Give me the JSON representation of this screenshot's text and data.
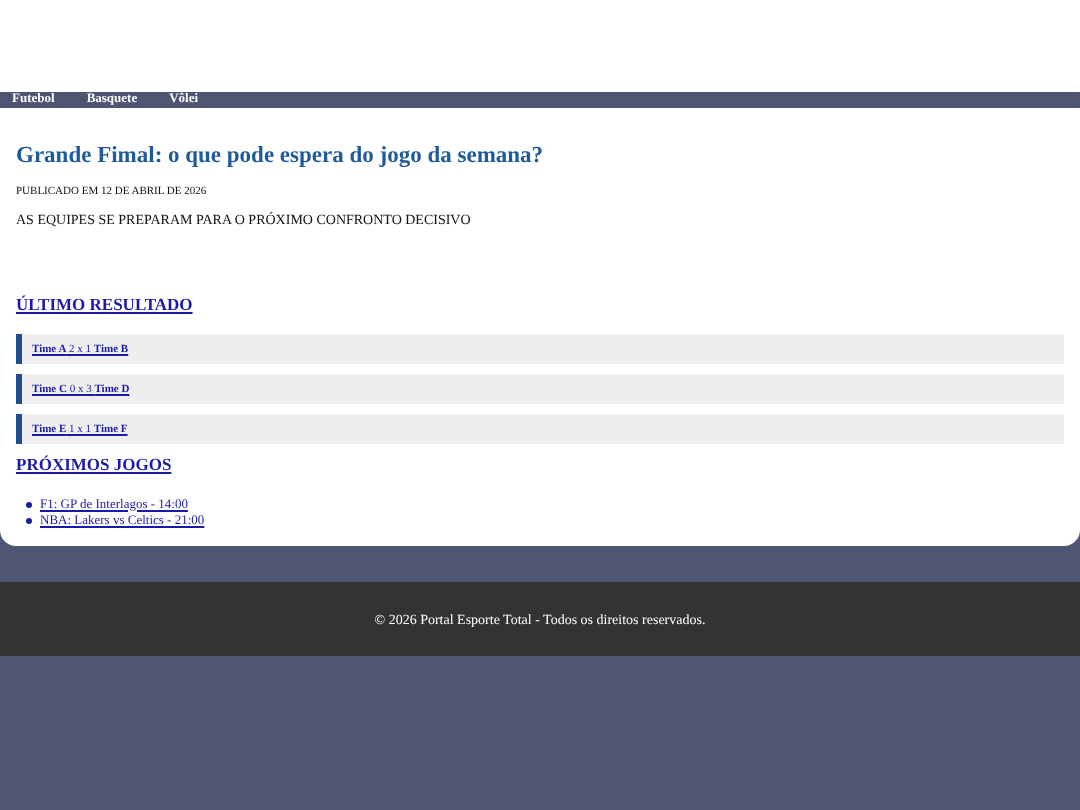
{
  "nav": {
    "items": [
      "Futebol",
      "Basquete",
      "Vôlei"
    ]
  },
  "article": {
    "title": "Grande Fimal: o que pode espera do jogo da semana?",
    "date": "PUBLICADO EM 12 DE ABRIL DE 2026",
    "subtitle": "AS EQUIPES SE PREPARAM PARA O PRÓXIMO CONFRONTO DECISIVO"
  },
  "results": {
    "heading": "ÚLTIMO RESULTADO",
    "items": [
      "**Time A** 2 x 1 **Time B**",
      "**Time C** 0 x 3 **Time D**",
      "**Time E** 1 x 1 **Time F**"
    ]
  },
  "upcoming": {
    "heading": "PRÓXIMOS JOGOS",
    "items": [
      "F1: GP de Interlagos - 14:00",
      "NBA: Lakers vs Celtics - 21:00"
    ]
  },
  "footer": {
    "text": "© 2026 Portal Esporte Total - Todos os direitos reservados."
  }
}
